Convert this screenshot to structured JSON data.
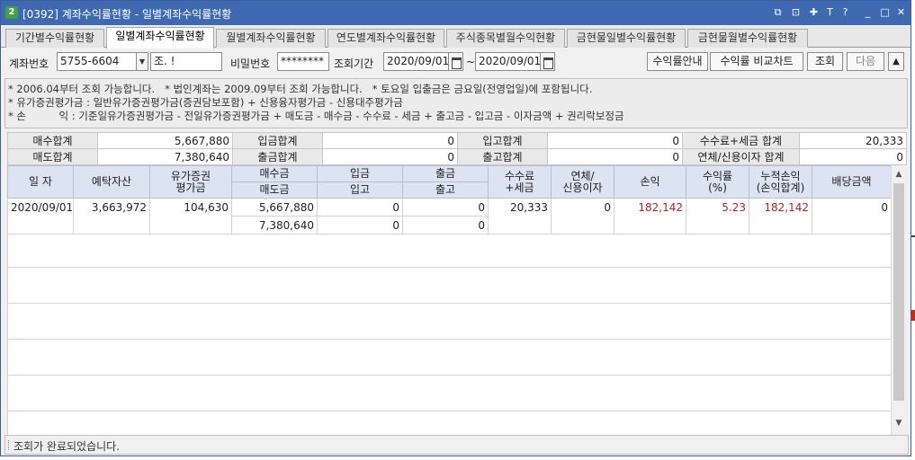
{
  "window": {
    "badge": "2",
    "title": "[0392] 계좌수익률현황 - 일별계좌수익률현황",
    "controls": [
      "⧉",
      "⊡",
      "✚",
      "T",
      "?",
      "_",
      "□",
      "✕"
    ]
  },
  "tabs": [
    {
      "label": "기간별수익률현황",
      "active": false
    },
    {
      "label": "일별계좌수익률현황",
      "active": true
    },
    {
      "label": "월별계좌수익률현황",
      "active": false
    },
    {
      "label": "연도별계좌수익률현황",
      "active": false
    },
    {
      "label": "주식종목별월수익현황",
      "active": false
    },
    {
      "label": "금현물일별수익률현황",
      "active": false
    },
    {
      "label": "금현물월별수익률현황",
      "active": false
    }
  ],
  "query": {
    "account_label": "계좌번호",
    "account_value": "5755-6604",
    "account_name": "조.  !",
    "password_label": "비밀번호",
    "password_value": "********",
    "period_label": "조회기간",
    "date_from": "2020/09/01",
    "date_sep": "~",
    "date_to": "2020/09/01",
    "buttons": {
      "guide": "수익률안내",
      "compare": "수익률 비교차트",
      "search": "조회",
      "next": "다음",
      "up": "▲"
    }
  },
  "notice": [
    "* 2006.04부터 조회 가능합니다.   * 법인계좌는 2009.09부터 조회 가능합니다.   * 토요일 입출금은 금요일(전영업일)에 포함됩니다.",
    "* 유가증권평가금 : 일반유가증권평가금(증권담보포함) + 신용융자평가금 - 신용대주평가금",
    "* 손          익 : 기준일유가증권평가금 - 전일유가증권평가금 + 매도금 - 매수금 - 수수료 - 세금 + 출고금 - 입고금 - 이자금액 + 권리락보정금"
  ],
  "summary": {
    "row1": [
      {
        "label": "매수합계",
        "value": "5,667,880"
      },
      {
        "label": "입금합계",
        "value": "0"
      },
      {
        "label": "입고합계",
        "value": "0"
      },
      {
        "label": "수수료+세금 합계",
        "value": "20,333"
      }
    ],
    "row2": [
      {
        "label": "매도합계",
        "value": "7,380,640"
      },
      {
        "label": "출금합계",
        "value": "0"
      },
      {
        "label": "출고합계",
        "value": "0"
      },
      {
        "label": "연체/신용이자 합계",
        "value": "0"
      }
    ]
  },
  "grid": {
    "headers": {
      "date": "일  자",
      "deposit_assets": "예탁자산",
      "securities_eval_1": "유가증권",
      "securities_eval_2": "평가금",
      "buy_amount": "매수금",
      "sell_amount": "매도금",
      "deposit_in": "입금",
      "stock_in": "입고",
      "withdraw": "출금",
      "stock_out": "출고",
      "fee_tax_1": "수수료",
      "fee_tax_2": "+세금",
      "overdue_1": "연체/",
      "overdue_2": "신용이자",
      "profit": "손익",
      "return_rate_1": "수익률",
      "return_rate_2": "(%)",
      "cum_profit_1": "누적손익",
      "cum_profit_2": "(손익합계)",
      "dividend": "배당금액"
    },
    "rows": [
      {
        "date": "2020/09/01",
        "deposit_assets": "3,663,972",
        "securities_eval": "104,630",
        "buy_amount": "5,667,880",
        "sell_amount": "7,380,640",
        "deposit_in": "0",
        "stock_in": "0",
        "withdraw": "0",
        "stock_out": "0",
        "fee_tax": "20,333",
        "overdue_interest": "0",
        "profit": "182,142",
        "return_rate": "5.23",
        "cum_profit": "182,142",
        "dividend": "0"
      }
    ]
  },
  "status": {
    "message": "조회가 완료되었습니다."
  },
  "colors": {
    "titlebar": "#3f69b1",
    "header_bg": "#dbe4f0",
    "profit_red": "#b22222"
  }
}
